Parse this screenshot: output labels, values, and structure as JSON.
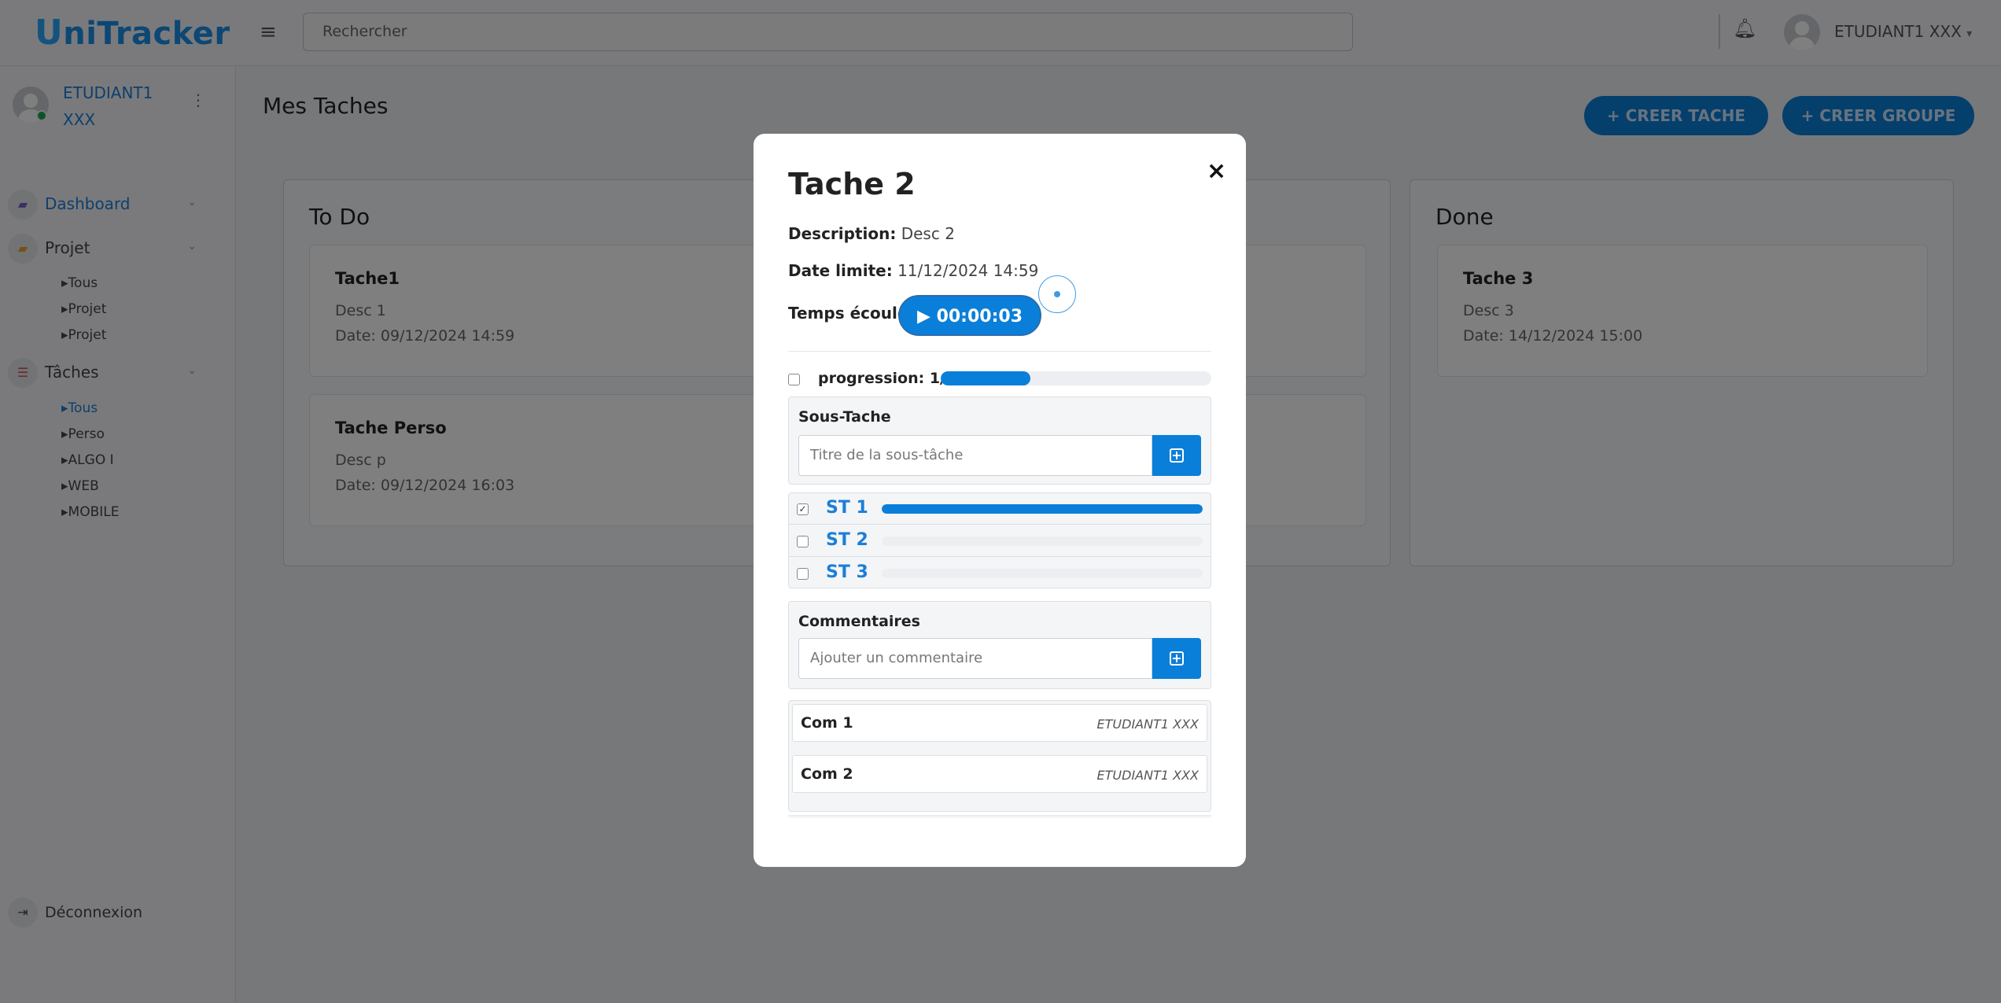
{
  "app": {
    "logo_first": "U",
    "logo_rest": "niTracker"
  },
  "header": {
    "menu_icon": "hamburger-icon",
    "search_placeholder": "Rechercher",
    "notification_icon": "bell-icon",
    "user_name": "ETUDIANT1 XXX"
  },
  "sidebar": {
    "user_name": "ETUDIANT1 XXX",
    "status_color": "#1aa64a",
    "nav": {
      "dashboard": "Dashboard",
      "projet": "Projet",
      "taches": "Tâches"
    },
    "projet_items": [
      "Tous",
      "Projet",
      "Projet"
    ],
    "taches_items": [
      "Tous",
      "Perso",
      "ALGO I",
      "WEB",
      "MOBILE"
    ],
    "logout": "Déconnexion"
  },
  "main": {
    "title": "Mes Taches",
    "create_task": "+ CREER TACHE",
    "create_group": "+ CREER GROUPE",
    "columns": [
      {
        "title": "To Do",
        "cards": [
          {
            "title": "Tache1",
            "desc": "Desc 1",
            "date": "Date: 09/12/2024 14:59"
          },
          {
            "title": "Tache Perso",
            "desc": "Desc p",
            "date": "Date: 09/12/2024 16:03"
          }
        ]
      },
      {
        "title": "Done",
        "cards": [
          {
            "title": "Tache 3",
            "desc": "Desc 3",
            "date": "Date: 14/12/2024 15:00"
          }
        ]
      }
    ]
  },
  "modal": {
    "title": "Tache 2",
    "close": "×",
    "description_label": "Description:",
    "description": "Desc 2",
    "deadline_label": "Date limite:",
    "deadline": "11/12/2024 14:59",
    "elapsed_label": "Temps écoulé :",
    "timer": "00:00:03",
    "progress_label": "progression:",
    "progress_text": "1/3",
    "progress_fraction": 0.33,
    "subtasks_title": "Sous-Tache",
    "subtask_placeholder": "Titre de la sous-tâche",
    "subtasks": [
      {
        "name": "ST 1",
        "checked": true,
        "progress": 1.0
      },
      {
        "name": "ST 2",
        "checked": false,
        "progress": 0
      },
      {
        "name": "ST 3",
        "checked": false,
        "progress": 0
      }
    ],
    "comments_title": "Commentaires",
    "comment_placeholder": "Ajouter un commentaire",
    "comments": [
      {
        "text": "Com 1",
        "author": "ETUDIANT1 XXX"
      },
      {
        "text": "Com 2",
        "author": "ETUDIANT1 XXX"
      }
    ],
    "accent_color": "#0a7fd9"
  }
}
